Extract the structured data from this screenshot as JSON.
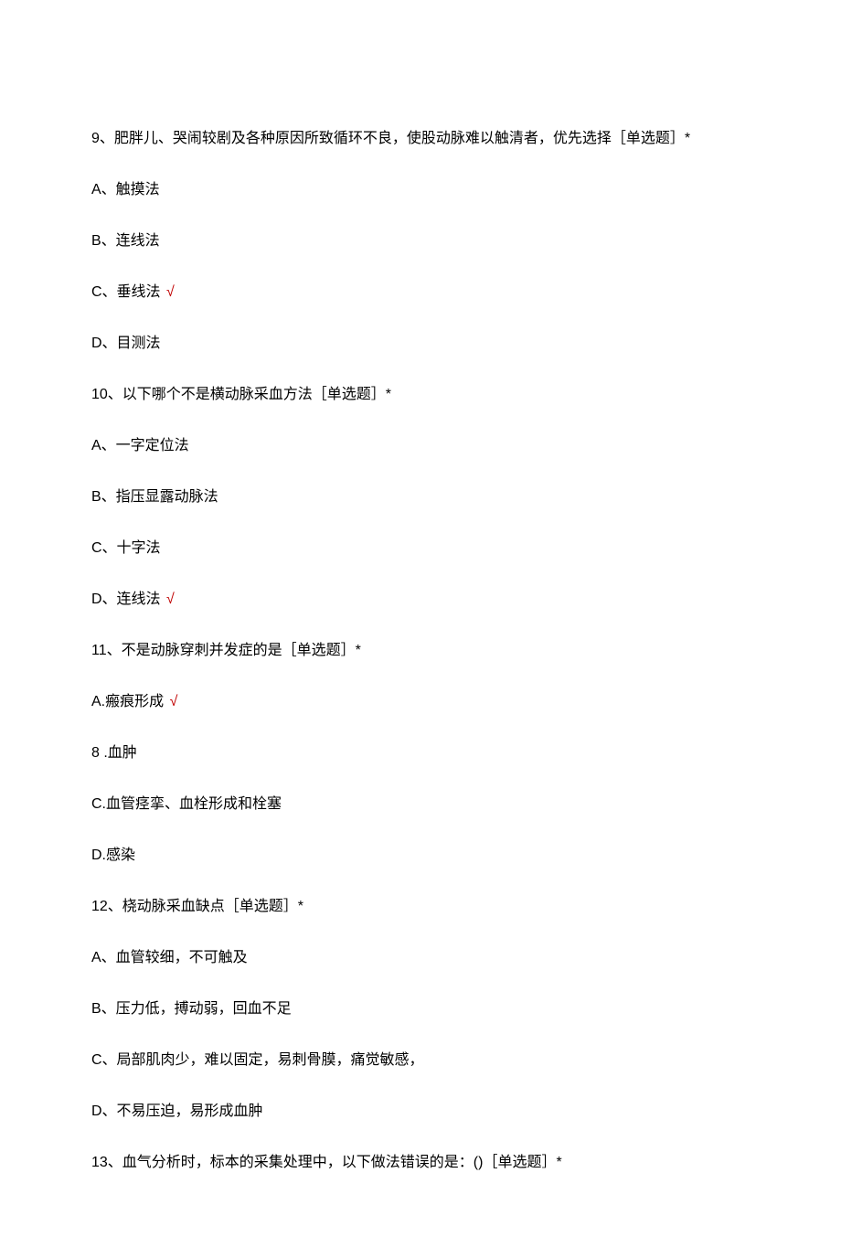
{
  "check_mark": "√",
  "questions": [
    {
      "stem": "9、肥胖儿、哭闹较剧及各种原因所致循环不良，使股动脉难以触清者，优先选择［单选题］*",
      "options": [
        {
          "text": "A、触摸法",
          "correct": false
        },
        {
          "text": "B、连线法",
          "correct": false
        },
        {
          "text": "C、垂线法",
          "correct": true
        },
        {
          "text": "D、目测法",
          "correct": false
        }
      ]
    },
    {
      "stem": "10、以下哪个不是横动脉采血方法［单选题］*",
      "options": [
        {
          "text": "A、一字定位法",
          "correct": false
        },
        {
          "text": "B、指压显露动脉法",
          "correct": false
        },
        {
          "text": "C、十字法",
          "correct": false
        },
        {
          "text": "D、连线法",
          "correct": true
        }
      ]
    },
    {
      "stem": "11、不是动脉穿刺并发症的是［单选题］*",
      "options": [
        {
          "text": "A.瘢痕形成",
          "correct": true
        },
        {
          "text": "8 .血肿",
          "correct": false
        },
        {
          "text": "C.血管痉挛、血栓形成和栓塞",
          "correct": false
        },
        {
          "text": "D.感染",
          "correct": false
        }
      ]
    },
    {
      "stem": "12、桡动脉采血缺点［单选题］*",
      "options": [
        {
          "text": "A、血管较细，不可触及",
          "correct": false
        },
        {
          "text": "B、压力低，搏动弱，回血不足",
          "correct": false
        },
        {
          "text": "C、局部肌肉少，难以固定，易刺骨膜，痛觉敏感，",
          "correct": false
        },
        {
          "text": "D、不易压迫，易形成血肿",
          "correct": false
        }
      ]
    },
    {
      "stem": "13、血气分析时，标本的采集处理中，以下做法错误的是：()［单选题］*",
      "options": []
    }
  ]
}
